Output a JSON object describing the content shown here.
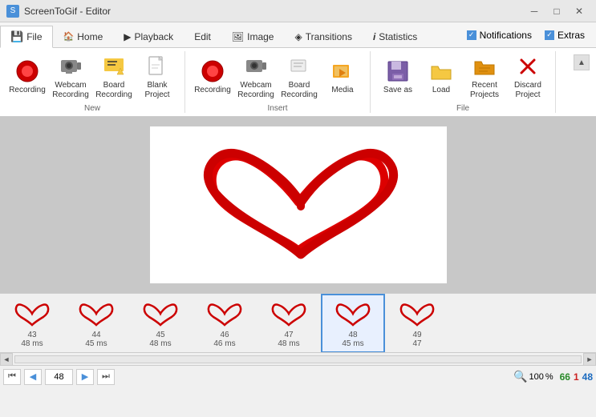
{
  "titlebar": {
    "appname": "ScreenToGif - Editor",
    "icon": "🎬",
    "btns": [
      "─",
      "□",
      "✕"
    ]
  },
  "tabs": [
    {
      "id": "file",
      "label": "File",
      "icon": "💾",
      "active": true
    },
    {
      "id": "home",
      "label": "Home",
      "icon": "🏠",
      "active": false
    },
    {
      "id": "playback",
      "label": "Playback",
      "icon": "▶",
      "active": false
    },
    {
      "id": "edit",
      "label": "Edit",
      "icon": "",
      "active": false
    },
    {
      "id": "image",
      "label": "Image",
      "icon": "🖼",
      "active": false
    },
    {
      "id": "transitions",
      "label": "Transitions",
      "icon": "◈",
      "active": false
    },
    {
      "id": "statistics",
      "label": "Statistics",
      "icon": "i",
      "active": false
    }
  ],
  "toggles": [
    {
      "id": "notifications",
      "label": "Notifications",
      "checked": true
    },
    {
      "id": "extras",
      "label": "Extras",
      "checked": true
    }
  ],
  "ribbon_groups": [
    {
      "id": "new",
      "label": "New",
      "items": [
        {
          "id": "recording",
          "icon": "🔴",
          "label": "Recording"
        },
        {
          "id": "webcam-recording",
          "icon": "📷",
          "label": "Webcam\nRecording"
        },
        {
          "id": "board-recording",
          "icon": "⭐",
          "label": "Board\nRecording"
        },
        {
          "id": "blank-project",
          "icon": "📄",
          "label": "Blank\nProject"
        }
      ]
    },
    {
      "id": "insert",
      "label": "Insert",
      "items": [
        {
          "id": "recording2",
          "icon": "🔴",
          "label": "Recording"
        },
        {
          "id": "webcam-recording2",
          "icon": "📷",
          "label": "Webcam\nRecording"
        },
        {
          "id": "board-recording2",
          "icon": "📋",
          "label": "Board\nRecording"
        },
        {
          "id": "media",
          "icon": "📁",
          "label": "Media"
        }
      ]
    },
    {
      "id": "file-group",
      "label": "File",
      "items": [
        {
          "id": "save-as",
          "icon": "💾",
          "label": "Save as"
        },
        {
          "id": "load",
          "icon": "📂",
          "label": "Load"
        },
        {
          "id": "recent-projects",
          "icon": "📁",
          "label": "Recent\nProjects"
        },
        {
          "id": "discard-project",
          "icon": "✕",
          "label": "Discard\nProject"
        }
      ]
    }
  ],
  "frames": [
    {
      "num": "43",
      "ms": "48 ms",
      "selected": false
    },
    {
      "num": "44",
      "ms": "45 ms",
      "selected": false
    },
    {
      "num": "45",
      "ms": "48 ms",
      "selected": false
    },
    {
      "num": "46",
      "ms": "46 ms",
      "selected": false
    },
    {
      "num": "47",
      "ms": "48 ms",
      "selected": false
    },
    {
      "num": "48",
      "ms": "45 ms",
      "selected": true
    },
    {
      "num": "49",
      "ms": "47",
      "selected": false
    }
  ],
  "bottom": {
    "prev_label": "◀",
    "next_label": "▶",
    "first_label": "⏮",
    "last_label": "⏭",
    "zoom_label": "🔍",
    "zoom_value": "100",
    "zoom_unit": "%",
    "stat_green": "66",
    "stat_red": "1",
    "stat_blue": "48",
    "frame_input": "48"
  }
}
